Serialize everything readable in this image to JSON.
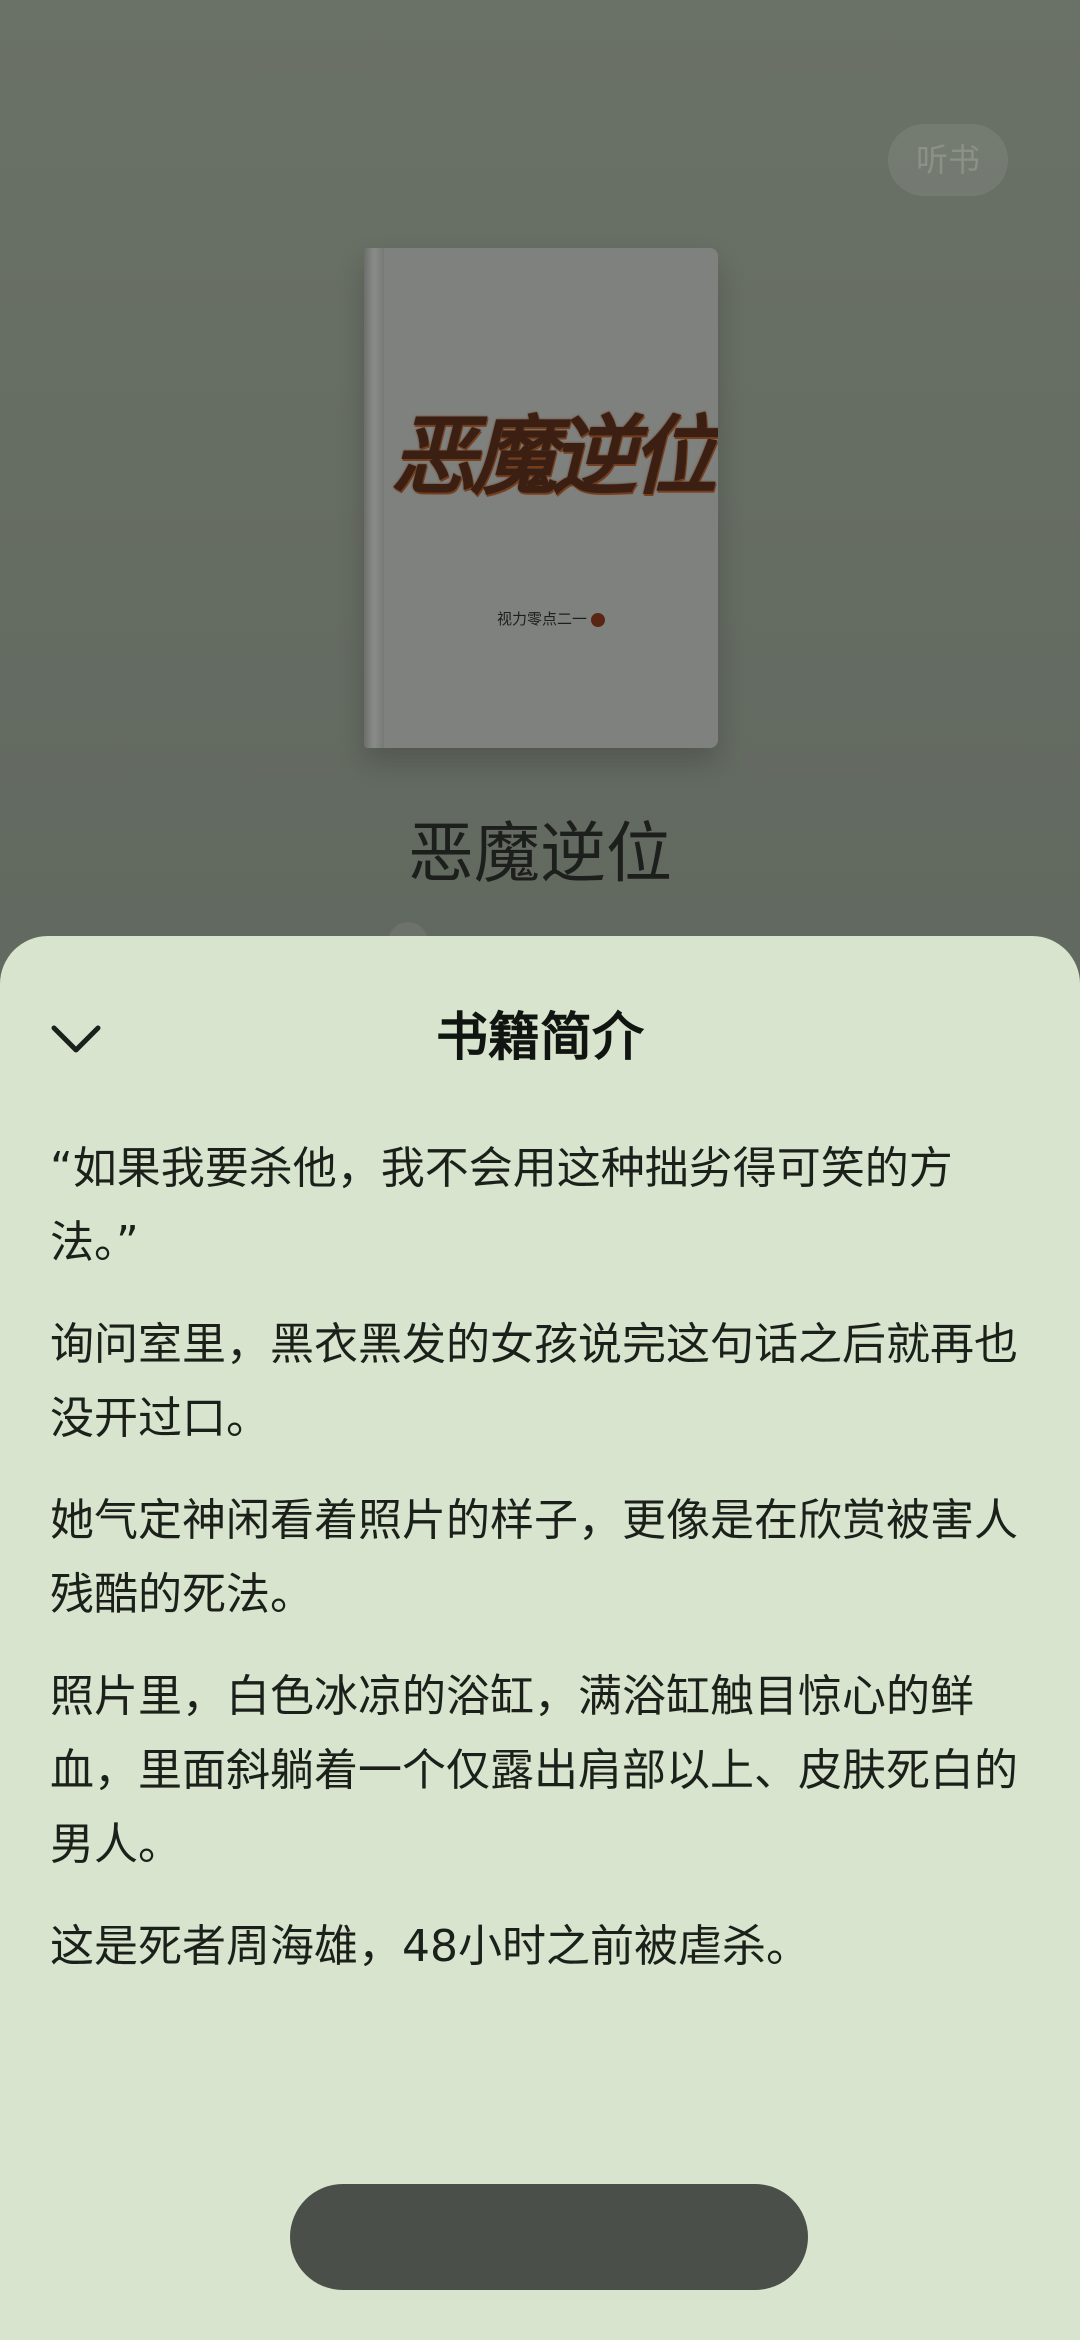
{
  "background": {
    "listen_label": "听书",
    "cover": {
      "title": "恶魔逆位",
      "author": "视力零点二一"
    },
    "book_title": "恶魔逆位"
  },
  "sheet": {
    "title": "书籍简介",
    "paragraphs": [
      "“如果我要杀他，我不会用这种拙劣得可笑的方法。”",
      "询问室里，黑衣黑发的女孩说完这句话之后就再也没开过口。",
      "她气定神闲看着照片的样子，更像是在欣赏被害人残酷的死法。",
      "照片里，白色冰凉的浴缸，满浴缸触目惊心的鲜血，里面斜躺着一个仅露出肩部以上、皮肤死白的男人。",
      "这是死者周海雄，48小时之前被虐杀。"
    ]
  },
  "icons": {
    "close": "chevron-down-icon"
  },
  "colors": {
    "sheet_bg": "#d8e4cd",
    "overlay_bg": "#5f655d",
    "button_bg": "#4b4f4a"
  }
}
